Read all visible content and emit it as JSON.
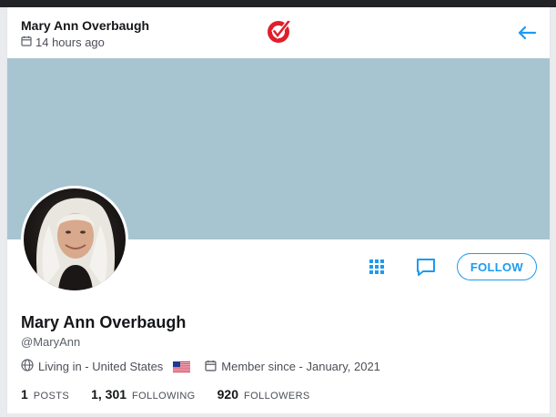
{
  "post": {
    "author_name": "Mary Ann Overbaugh",
    "time_ago": "14 hours ago"
  },
  "icons": {
    "calendar": "calendar-icon",
    "back": "arrow-left-icon",
    "logo": "checkmark-logo",
    "grid": "grid-icon",
    "message": "message-icon",
    "globe": "globe-icon",
    "flag": "us-flag-icon"
  },
  "colors": {
    "accent": "#1d9bf0",
    "cover": "#a7c4d1",
    "logo_red": "#e01e2b"
  },
  "profile": {
    "name": "Mary Ann Overbaugh",
    "handle": "@MaryAnn",
    "location": "Living in - United States",
    "member_since": "Member since - January, 2021",
    "follow_label": "FOLLOW"
  },
  "stats": [
    {
      "value": "1",
      "label": "POSTS"
    },
    {
      "value": "1, 301",
      "label": "FOLLOWING"
    },
    {
      "value": "920",
      "label": "FOLLOWERS"
    }
  ]
}
